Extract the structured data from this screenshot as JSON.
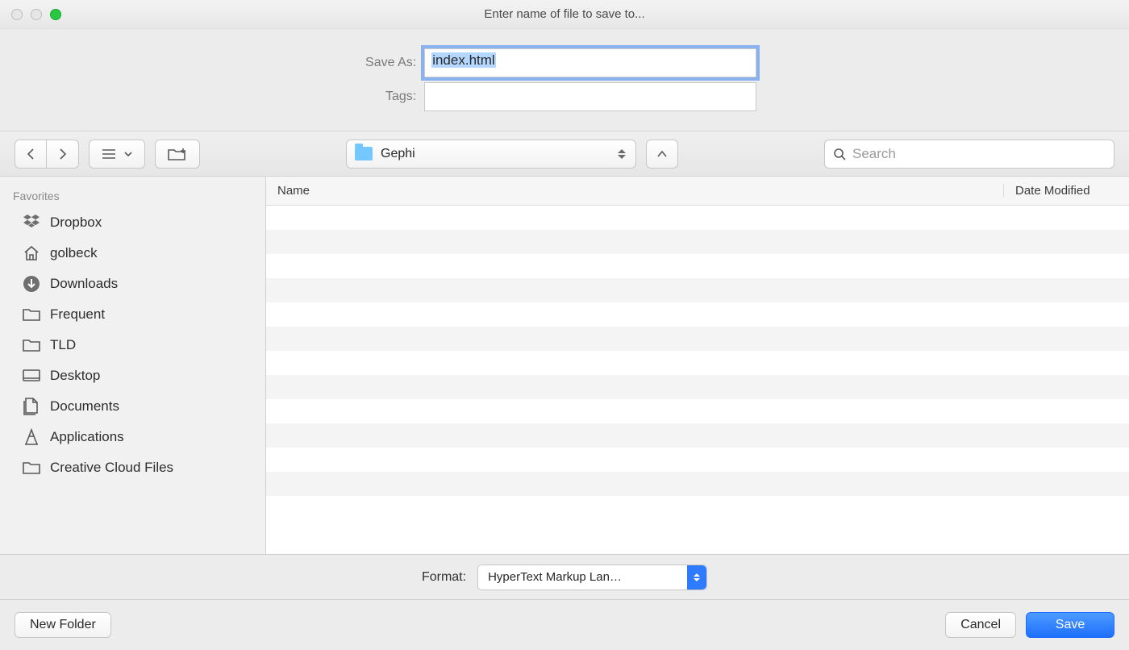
{
  "titlebar": {
    "title": "Enter name of file to save to..."
  },
  "save": {
    "save_as_label": "Save As:",
    "filename": "index.html",
    "tags_label": "Tags:",
    "tags_value": ""
  },
  "pathbar": {
    "folder_name": "Gephi",
    "search_placeholder": "Search"
  },
  "sidebar": {
    "header": "Favorites",
    "items": [
      {
        "icon": "dropbox-icon",
        "label": "Dropbox"
      },
      {
        "icon": "home-icon",
        "label": "golbeck"
      },
      {
        "icon": "downloads-icon",
        "label": "Downloads"
      },
      {
        "icon": "folder-icon",
        "label": "Frequent"
      },
      {
        "icon": "folder-icon",
        "label": "TLD"
      },
      {
        "icon": "desktop-icon",
        "label": "Desktop"
      },
      {
        "icon": "documents-icon",
        "label": "Documents"
      },
      {
        "icon": "applications-icon",
        "label": "Applications"
      },
      {
        "icon": "folder-icon",
        "label": "Creative Cloud Files"
      }
    ]
  },
  "columns": {
    "name": "Name",
    "date": "Date Modified"
  },
  "format": {
    "label": "Format:",
    "value": "HyperText Markup Lan…"
  },
  "actions": {
    "new_folder": "New Folder",
    "cancel": "Cancel",
    "save": "Save"
  }
}
